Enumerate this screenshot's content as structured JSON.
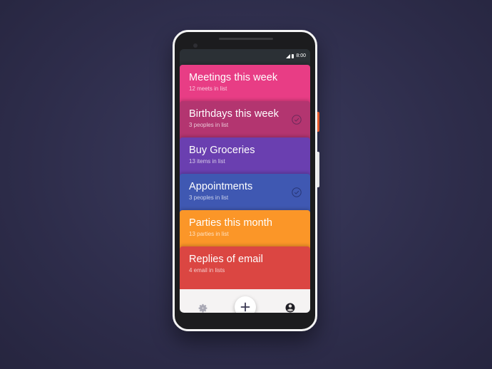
{
  "status_bar": {
    "time": "8:00"
  },
  "lists": [
    {
      "title": "Meetings this week",
      "subtitle": "12 meets in list",
      "color": "#e83d85",
      "done": false
    },
    {
      "title": "Birthdays this week",
      "subtitle": "3 peoples in list",
      "color": "#b33570",
      "done": true
    },
    {
      "title": "Buy Groceries",
      "subtitle": "13 items in list",
      "color": "#6a3fb0",
      "done": false
    },
    {
      "title": "Appointments",
      "subtitle": "3 peoples in list",
      "color": "#3f58b2",
      "done": true
    },
    {
      "title": "Parties this month",
      "subtitle": "13 parties in list",
      "color": "#fb9628",
      "done": false
    },
    {
      "title": "Replies of email",
      "subtitle": "4 email in lists",
      "color": "#db4642",
      "done": false
    }
  ],
  "bottom_nav": {
    "left_icon": "gear-icon",
    "center_icon": "plus-icon",
    "right_icon": "avatar-icon"
  },
  "colors": {
    "background": "#2e2d4b",
    "bottom_bar": "#f5f3f3",
    "icon_gray": "#a9a8b4",
    "check_stroke": "rgba(40,30,70,0.45)"
  }
}
